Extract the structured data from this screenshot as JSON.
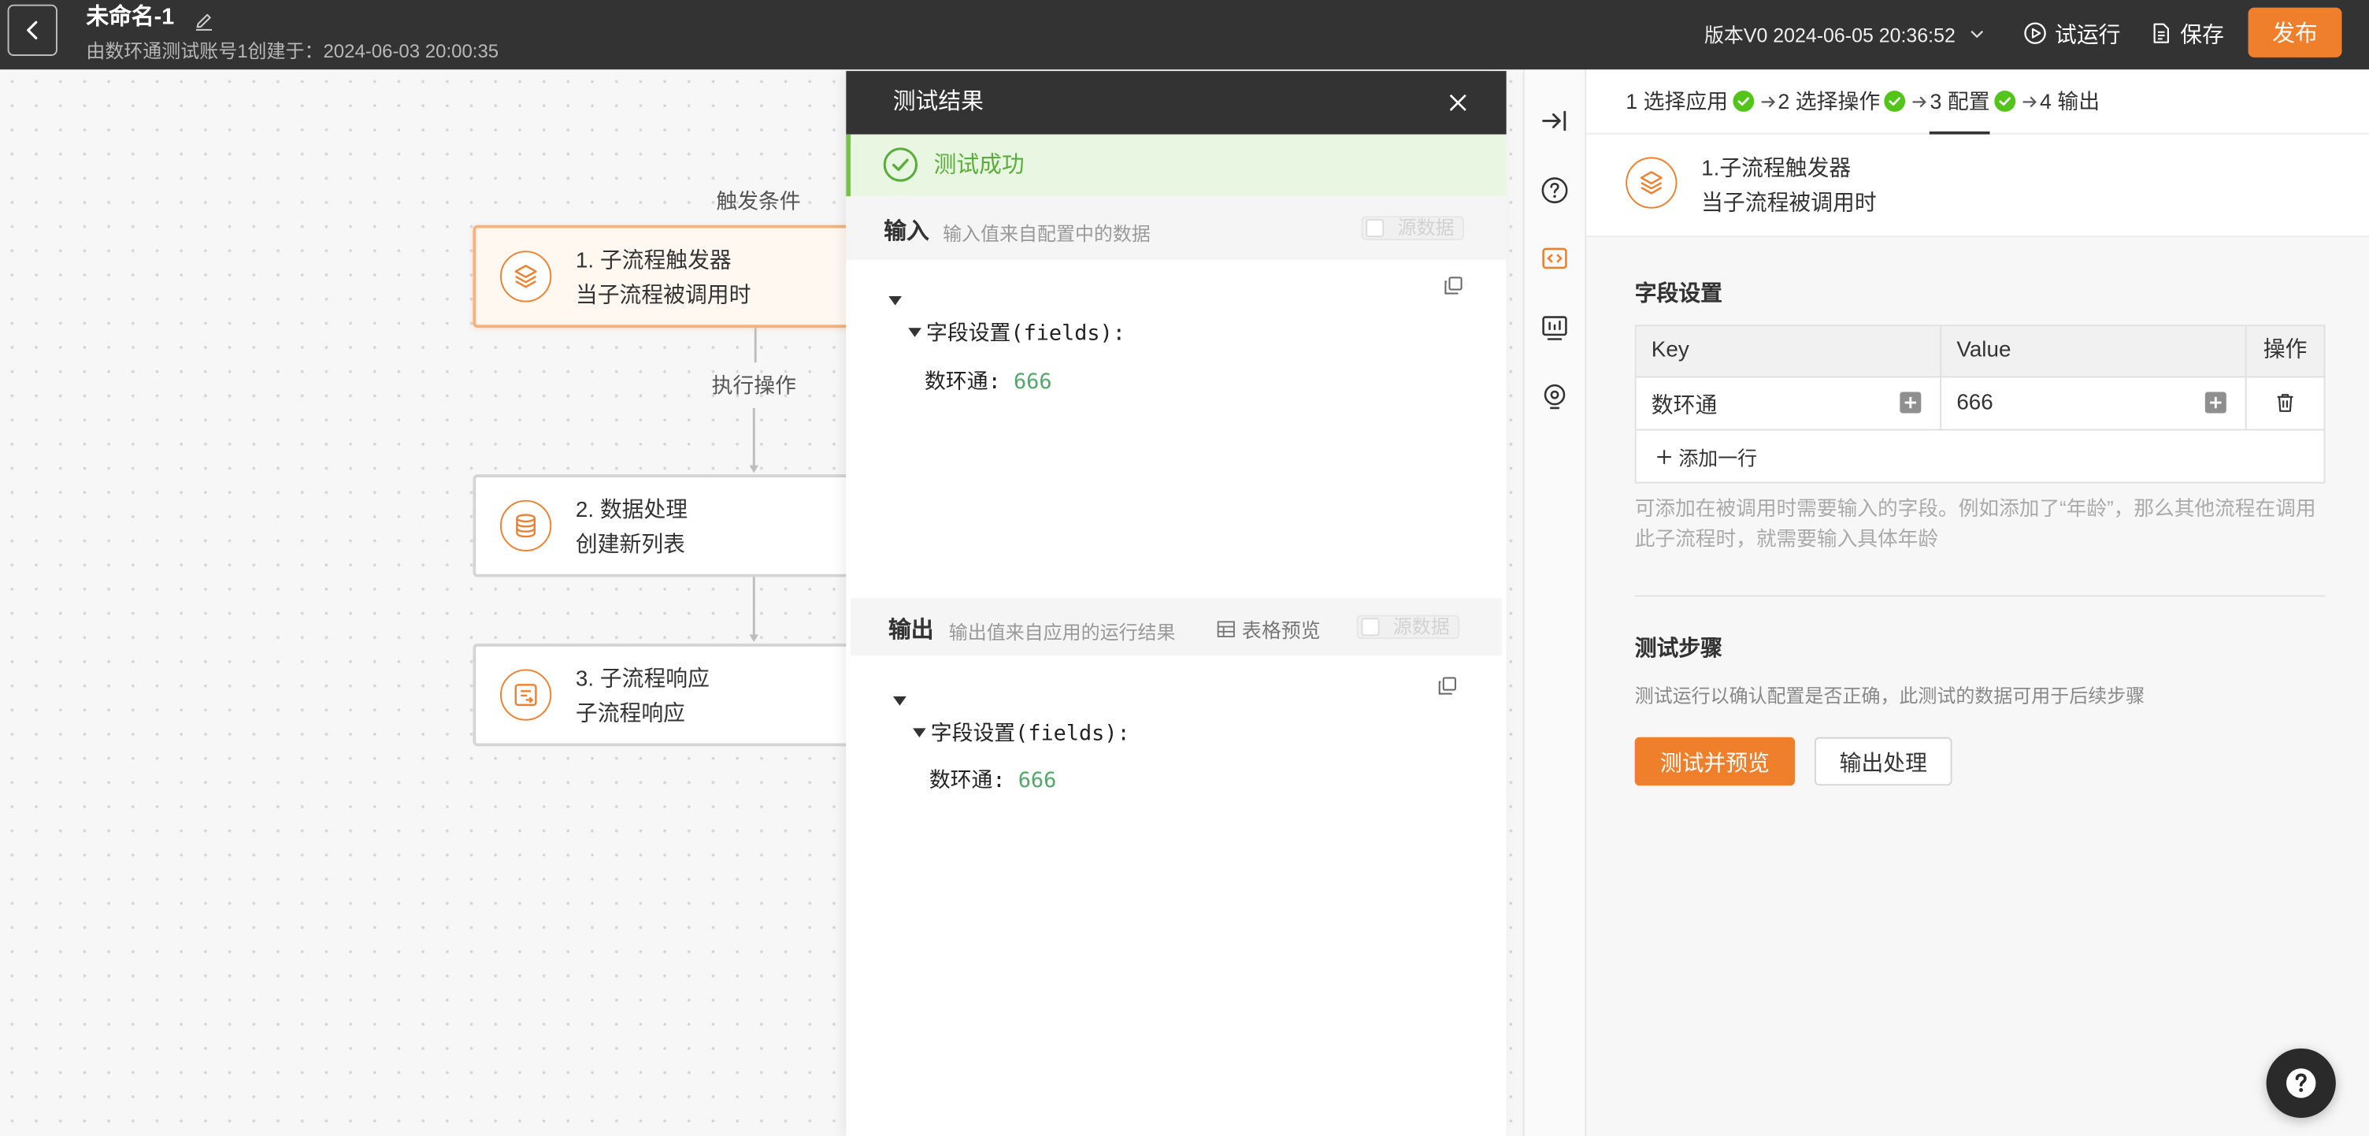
{
  "header": {
    "title": "未命名-1",
    "subtitle": "由数环通测试账号1创建于：2024-06-03 20:00:35",
    "version": "版本V0 2024-06-05 20:36:52",
    "test_run_label": "试运行",
    "save_label": "保存",
    "publish_label": "发布"
  },
  "canvas": {
    "trigger_label": "触发条件",
    "action_label": "执行操作",
    "nodes": [
      {
        "title": "1. 子流程触发器",
        "subtitle": "当子流程被调用时",
        "icon": "layers-icon"
      },
      {
        "title": "2. 数据处理",
        "subtitle": "创建新列表",
        "icon": "database-icon"
      },
      {
        "title": "3. 子流程响应",
        "subtitle": "子流程响应",
        "icon": "response-icon"
      }
    ]
  },
  "test_panel": {
    "title": "测试结果",
    "status": "测试成功",
    "input": {
      "label": "输入",
      "hint": "输入值来自配置中的数据",
      "raw_toggle": "源数据",
      "tree_key": "字段设置(fields):",
      "field_label": "数环通:",
      "field_value": "666"
    },
    "output": {
      "label": "输出",
      "hint": "输出值来自应用的运行结果",
      "table_preview": "表格预览",
      "raw_toggle": "源数据",
      "tree_key": "字段设置(fields):",
      "field_label": "数环通:",
      "field_value": "666"
    }
  },
  "toolbar": [
    {
      "icon": "collapse-panel-icon"
    },
    {
      "icon": "help-circle-icon"
    },
    {
      "icon": "code-icon",
      "active": true
    },
    {
      "icon": "dashboard-icon"
    },
    {
      "icon": "location-icon"
    }
  ],
  "config_panel": {
    "steps": [
      {
        "label": "1 选择应用",
        "done": true
      },
      {
        "label": "2 选择操作",
        "done": true
      },
      {
        "label": "3 配置",
        "done": true,
        "active": true
      },
      {
        "label": "4 输出",
        "done": false
      }
    ],
    "node": {
      "title": "1.子流程触发器",
      "subtitle": "当子流程被调用时",
      "icon": "layers-icon"
    },
    "fields": {
      "title": "字段设置",
      "columns": [
        "Key",
        "Value",
        "操作"
      ],
      "rows": [
        {
          "key": "数环通",
          "value": "666"
        }
      ],
      "add_row": "添加一行",
      "help": "可添加在被调用时需要输入的字段。例如添加了“年龄”，那么其他流程在调用此子流程时，就需要输入具体年龄"
    },
    "test": {
      "title": "测试步骤",
      "desc": "测试运行以确认配置是否正确，此测试的数据可用于后续步骤",
      "primary_button": "测试并预览",
      "secondary_button": "输出处理"
    }
  },
  "colors": {
    "accent": "#f07f2c",
    "success": "#52c41a",
    "topbar": "#333333",
    "value": "#52a86b"
  }
}
